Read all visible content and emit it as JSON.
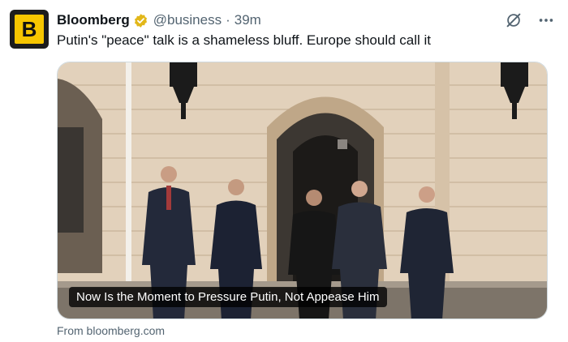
{
  "account": {
    "avatar_letter": "B",
    "name": "Bloomberg",
    "handle": "@business",
    "separator": "·",
    "time": "39m",
    "verified_color": "#e2b719"
  },
  "tweet": {
    "text": "Putin's \"peace\" talk is a shameless bluff. Europe should call it"
  },
  "card": {
    "headline": "Now Is the Moment to Pressure Putin, Not Appease Him",
    "source": "From bloomberg.com"
  },
  "icons": {
    "grok": "grok-icon",
    "more": "more-icon"
  }
}
